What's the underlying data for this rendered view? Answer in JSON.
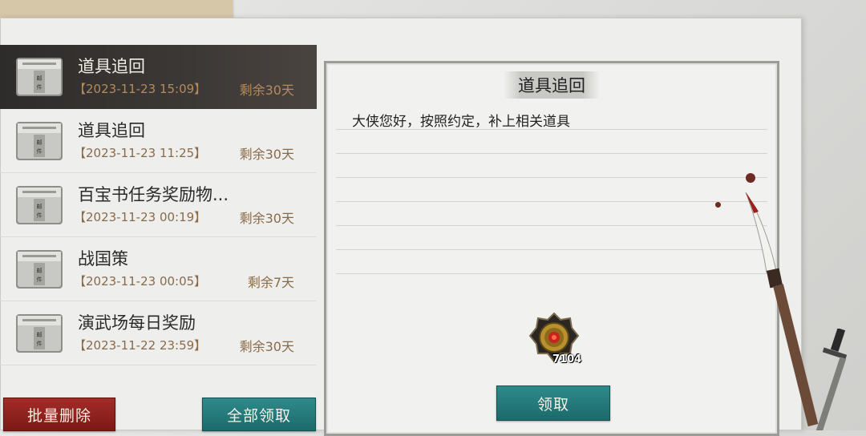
{
  "mail_list": [
    {
      "title": "道具追回",
      "date": "【2023-11-23 15:09】",
      "remaining": "剩余30天",
      "selected": true,
      "icon": "mail-icon"
    },
    {
      "title": "道具追回",
      "date": "【2023-11-23 11:25】",
      "remaining": "剩余30天",
      "selected": false,
      "icon": "mail-icon"
    },
    {
      "title": "百宝书任务奖励物...",
      "date": "【2023-11-23 00:19】",
      "remaining": "剩余30天",
      "selected": false,
      "icon": "mail-icon"
    },
    {
      "title": "战国策",
      "date": "【2023-11-23 00:05】",
      "remaining": "剩余7天",
      "selected": false,
      "icon": "mail-icon"
    },
    {
      "title": "演武场每日奖励",
      "date": "【2023-11-22 23:59】",
      "remaining": "剩余30天",
      "selected": false,
      "icon": "mail-icon"
    }
  ],
  "buttons": {
    "batch_delete": "批量删除",
    "claim_all": "全部领取",
    "claim": "领取"
  },
  "detail": {
    "title": "道具追回",
    "body": "大侠您好，按照约定，补上相关道具",
    "reward": {
      "icon": "medal-token-icon",
      "count": "7104"
    }
  },
  "colors": {
    "delete_button": "#8e2420",
    "claim_button": "#237a7b",
    "selected_row": "#34312f",
    "date_text": "#8a6a48"
  }
}
